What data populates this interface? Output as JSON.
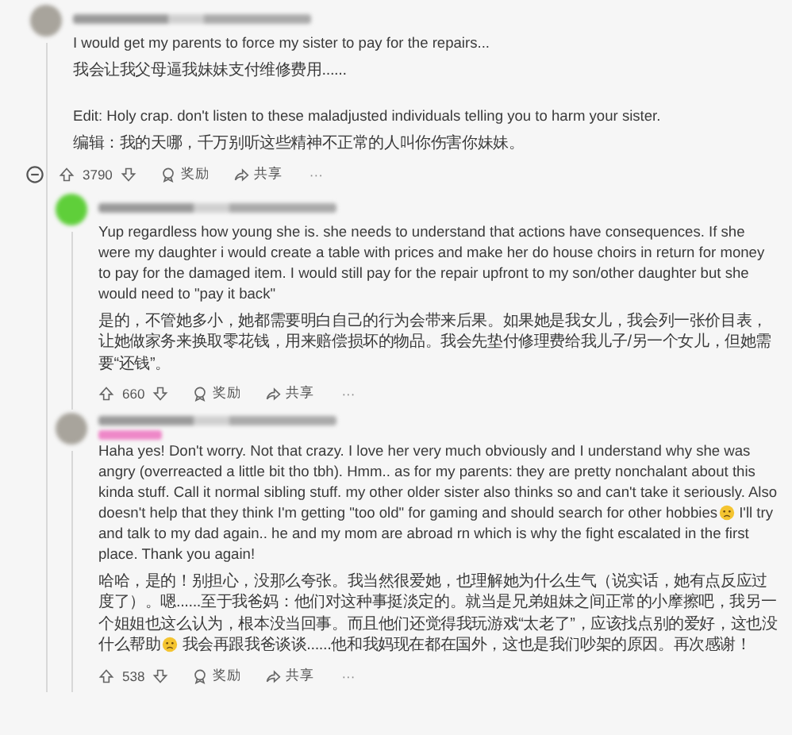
{
  "comments": [
    {
      "collapsible": true,
      "tag": false,
      "paragraphs": [
        {
          "kind": "en",
          "gap": false,
          "segments": [
            {
              "kind": "text",
              "text": "I would get my parents to force my sister to pay for the repairs..."
            }
          ]
        },
        {
          "kind": "zh",
          "gap": false,
          "segments": [
            {
              "kind": "text",
              "text": "我会让我父母逼我妹妹支付维修费用......"
            }
          ]
        },
        {
          "kind": "en",
          "gap": true,
          "segments": [
            {
              "kind": "text",
              "text": "Edit: Holy crap. don't listen to these maladjusted individuals telling you to harm your sister."
            }
          ]
        },
        {
          "kind": "zh",
          "gap": false,
          "segments": [
            {
              "kind": "text",
              "text": "编辑：我的天哪，千万别听这些精神不正常的人叫你伤害你妹妹。"
            }
          ]
        }
      ],
      "votes": "3790",
      "award": "奖励",
      "share": "共享",
      "more": "···",
      "children": [
        {
          "collapsible": false,
          "tag": false,
          "paragraphs": [
            {
              "kind": "en",
              "gap": false,
              "segments": [
                {
                  "kind": "text",
                  "text": "Yup regardless how young she is. she needs to understand that actions have consequences. If she were my daughter i would create a table with prices and make her do house choirs in return for money to pay for the damaged item. I would still pay for the repair upfront to my son/other daughter but she would need to \"pay it back\""
                }
              ]
            },
            {
              "kind": "zh",
              "gap": false,
              "segments": [
                {
                  "kind": "text",
                  "text": "是的，不管她多小，她都需要明白自己的行为会带来后果。如果她是我女儿，我会列一张价目表，让她做家务来换取零花钱，用来赔偿损坏的物品。我会先垫付修理费给我儿子/另一个女儿，但她需要“还钱”。"
                }
              ]
            }
          ],
          "votes": "660",
          "award": "奖励",
          "share": "共享",
          "more": "···"
        },
        {
          "collapsible": false,
          "tag": true,
          "paragraphs": [
            {
              "kind": "en",
              "gap": false,
              "segments": [
                {
                  "kind": "text",
                  "text": "Haha yes! Don't worry. Not that crazy. I love her very much obviously and I understand why she was angry (overreacted a little bit tho tbh). Hmm.. as for my parents: they are pretty nonchalant about this kinda stuff. Call it normal sibling stuff. my other older sister also thinks so and can't take it seriously. Also doesn't help that they think I'm getting \"too old\" for gaming and should search for other hobbies"
                },
                {
                  "kind": "emoji"
                },
                {
                  "kind": "text",
                  "text": " I'll try and talk to my dad again.. he and my mom are abroad rn which is why the fight escalated in the first place. Thank you again!"
                }
              ]
            },
            {
              "kind": "zh",
              "gap": false,
              "segments": [
                {
                  "kind": "text",
                  "text": "哈哈，是的！别担心，没那么夸张。我当然很爱她，也理解她为什么生气（说实话，她有点反应过度了）。嗯......至于我爸妈：他们对这种事挺淡定的。就当是兄弟姐妹之间正常的小摩擦吧，我另一个姐姐也这么认为，根本没当回事。而且他们还觉得我玩游戏“太老了”，应该找点别的爱好，这也没什么帮助"
                },
                {
                  "kind": "emoji"
                },
                {
                  "kind": "text",
                  "text": " 我会再跟我爸谈谈......他和我妈现在都在国外，这也是我们吵架的原因。再次感谢！"
                }
              ]
            }
          ],
          "votes": "538",
          "award": "奖励",
          "share": "共享",
          "more": "···"
        }
      ]
    }
  ]
}
